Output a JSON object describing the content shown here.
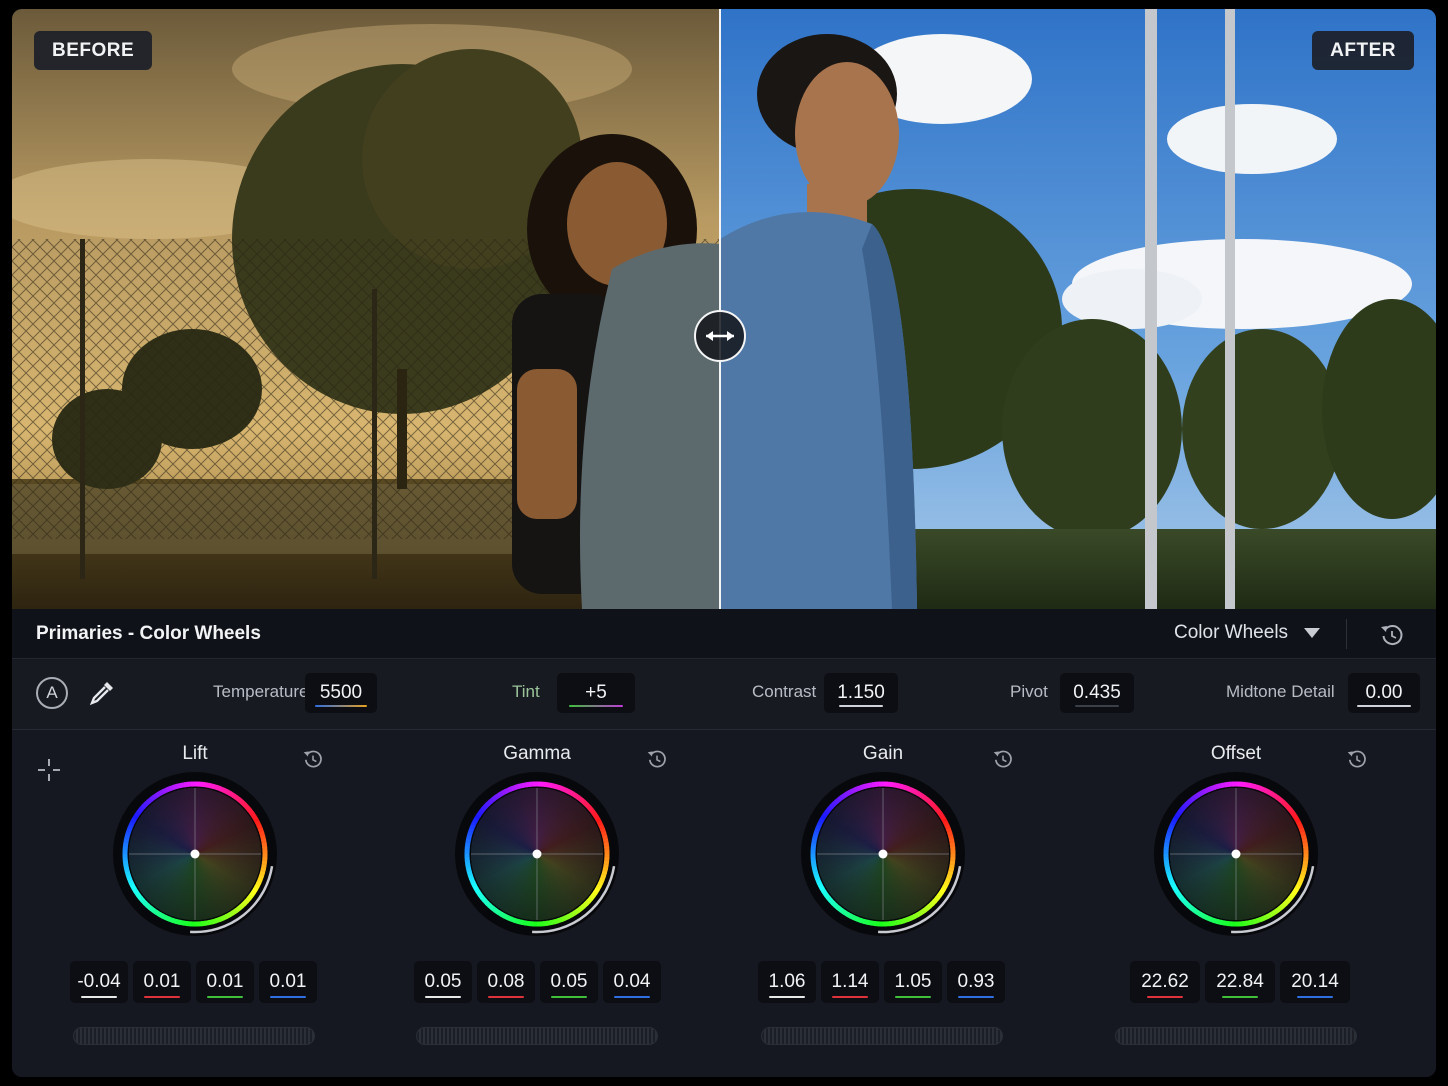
{
  "viewer": {
    "before_label": "BEFORE",
    "after_label": "AFTER"
  },
  "panel": {
    "title": "Primaries - Color Wheels",
    "mode": "Color Wheels"
  },
  "adjustments": {
    "auto_label": "A",
    "temperature": {
      "label": "Temperature",
      "value": "5500"
    },
    "tint": {
      "label": "Tint",
      "value": "+5"
    },
    "contrast": {
      "label": "Contrast",
      "value": "1.150"
    },
    "pivot": {
      "label": "Pivot",
      "value": "0.435"
    },
    "midtone_detail": {
      "label": "Midtone Detail",
      "value": "0.00"
    }
  },
  "wheels": [
    {
      "name": "Lift",
      "values": [
        "-0.04",
        "0.01",
        "0.01",
        "0.01"
      ]
    },
    {
      "name": "Gamma",
      "values": [
        "0.05",
        "0.08",
        "0.05",
        "0.04"
      ]
    },
    {
      "name": "Gain",
      "values": [
        "1.06",
        "1.14",
        "1.05",
        "0.93"
      ]
    },
    {
      "name": "Offset",
      "values": [
        "22.62",
        "22.84",
        "20.14"
      ]
    }
  ],
  "channel_colors": {
    "master": "#e8e8e8",
    "red": "#e0323a",
    "green": "#3fbf3a",
    "blue": "#2f6fe0"
  },
  "icons": [
    "crosshair-icon",
    "eyedropper-icon",
    "reset-icon",
    "chevron-down-icon",
    "split-arrows-icon"
  ]
}
